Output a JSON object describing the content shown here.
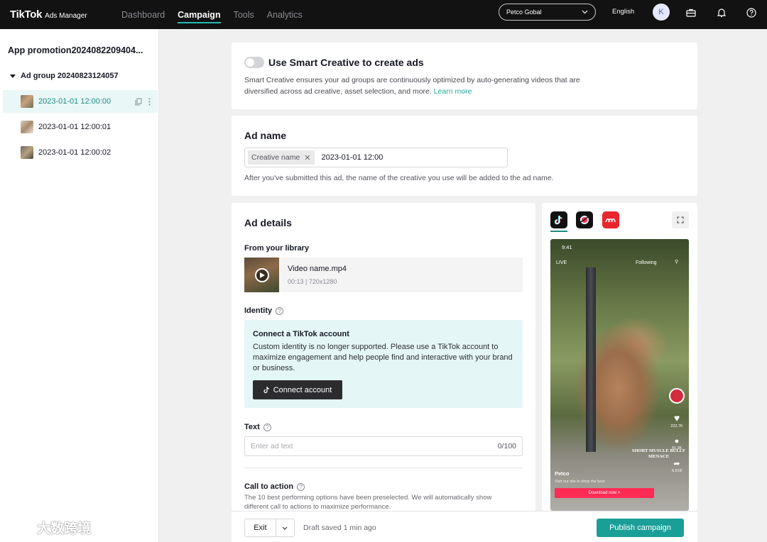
{
  "colors": {
    "accent": "#25b7b0",
    "topbar": "#121212",
    "primary_button": "#1a9f98",
    "connect_bg": "#e4f6f5",
    "tiktok_red": "#fe2c55"
  },
  "topbar": {
    "logo": "TikTok",
    "logo_sub": "Ads Manager",
    "nav": [
      "Dashboard",
      "Campaign",
      "Tools",
      "Analytics"
    ],
    "active_nav": "Campaign",
    "account": "Petco Gobal",
    "language": "English",
    "avatar_initial": "K",
    "icons": [
      "briefcase-icon",
      "bell-icon",
      "help-icon"
    ]
  },
  "sidebar": {
    "campaign": "App promotion2024082209404...",
    "ad_group": "Ad group 20240823124057",
    "ads": [
      "2023-01-01 12:00:00",
      "2023-01-01 12:00:01",
      "2023-01-01 12:00:02"
    ]
  },
  "smart_creative": {
    "title": "Use Smart Creative to create ads",
    "desc": "Smart Creative ensures your ad groups are continuously optimized by auto-generating videos that are diversified across ad creative, asset selection, and more.",
    "link": "Learn more",
    "enabled": false
  },
  "ad_name": {
    "title": "Ad name",
    "chip": "Creative name",
    "value": "2023-01-01 12:00",
    "help": "After you've submitted this ad, the name of the creative you use will be added to the ad name."
  },
  "ad_details": {
    "title": "Ad details",
    "library_label": "From your library",
    "video_name": "Video name.mp4",
    "video_meta": "00:13 | 720x1280",
    "identity_label": "Identity",
    "connect_title": "Connect a TikTok account",
    "connect_text": "Custom identity is no longer supported. Please use a TikTok account to maximize engagement and help people find and interactive with your brand or business.",
    "connect_button": "Connect account",
    "text_label": "Text",
    "text_placeholder": "Enter ad text",
    "text_count": "0/100",
    "cta_label": "Call to action",
    "cta_desc": "The 10 best performing options have been preselected. We will automatically show different call to actions to maximize performance."
  },
  "preview": {
    "time": "9:41",
    "live": "LIVE",
    "following": "Following",
    "brand": "Petco",
    "caption": "Visit our site to shop the best",
    "download": "Download now >",
    "overlay_title": "SHORT MUSCLE BULLY MENACE",
    "likes": "222.7K",
    "comments": "41.3K",
    "shares": "6,618"
  },
  "footer": {
    "exit": "Exit",
    "draft": "Draft saved 1 min ago",
    "publish": "Publish campaign"
  },
  "watermark": "大数跨境"
}
